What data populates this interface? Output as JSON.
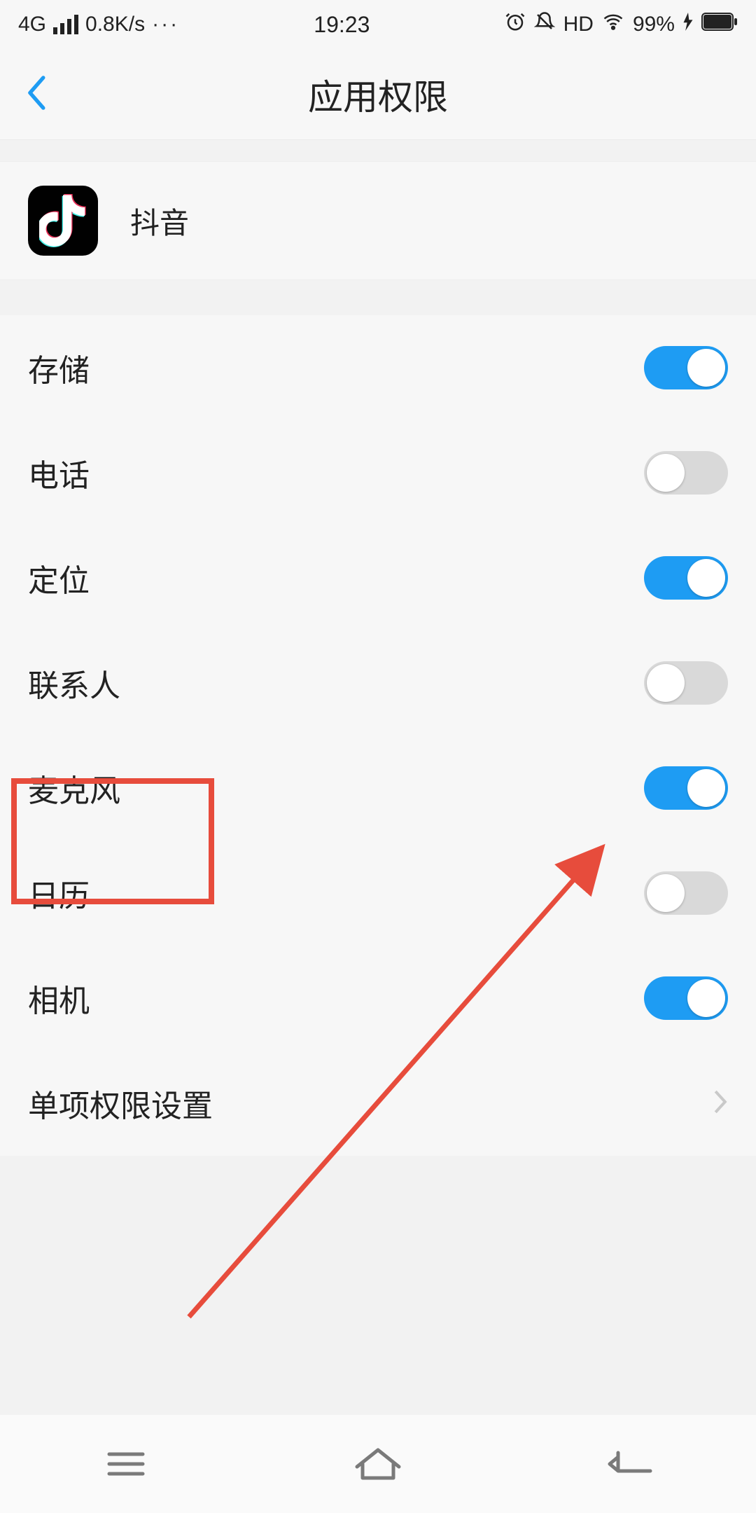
{
  "statusbar": {
    "network": "4G",
    "speed": "0.8K/s",
    "time": "19:23",
    "hd": "HD",
    "battery": "99%"
  },
  "header": {
    "title": "应用权限"
  },
  "app": {
    "name": "抖音"
  },
  "permissions": [
    {
      "label": "存储",
      "on": true
    },
    {
      "label": "电话",
      "on": false
    },
    {
      "label": "定位",
      "on": true
    },
    {
      "label": "联系人",
      "on": false
    },
    {
      "label": "麦克风",
      "on": true
    },
    {
      "label": "日历",
      "on": false
    },
    {
      "label": "相机",
      "on": true
    }
  ],
  "more": {
    "label": "单项权限设置"
  },
  "annotation": {
    "highlight_index": 4,
    "arrow_from_toggle_index": 4
  }
}
